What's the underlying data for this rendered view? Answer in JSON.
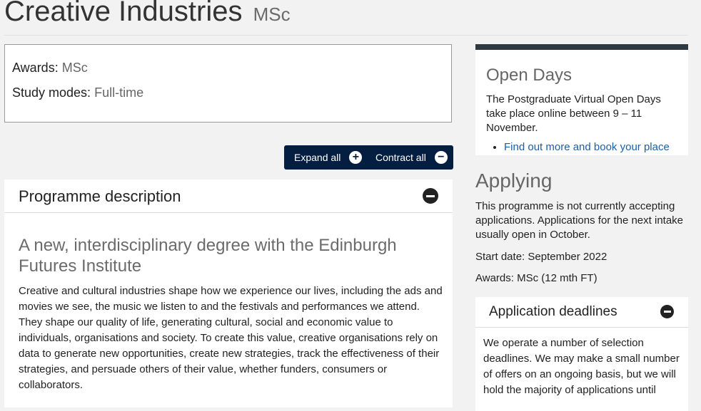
{
  "header": {
    "title": "Creative Industries",
    "award": "MSc"
  },
  "summary": {
    "awards_label": "Awards:",
    "awards_value": "MSc",
    "study_modes_label": "Study modes:",
    "study_modes_value": "Full-time"
  },
  "toolbar": {
    "expand_label": "Expand all",
    "contract_label": "Contract all",
    "expand_icon": "plus-circle-icon",
    "contract_icon": "minus-circle-icon"
  },
  "programme": {
    "section_title": "Programme description",
    "collapse_icon": "minus-circle-icon",
    "subheading": "A new, interdisciplinary degree with the Edinburgh Futures Institute",
    "body": "Creative and cultural industries shape how we experience our lives, including the ads and movies we see, the music we listen to and the festivals and performances we attend. They shape our quality of life, generating cultural, social and economic value to individuals, organisations and society. To create this value, creative organisations rely on data to generate new opportunities, create new strategies, track the effectiveness of their strategies, and persuade others of their value, whether funders, consumers or collaborators."
  },
  "open_days": {
    "title": "Open Days",
    "text": "The Postgraduate Virtual Open Days take place online between 9 – 11 November.",
    "link": "Find out more and book your place"
  },
  "applying": {
    "title": "Applying",
    "text": "This programme is not currently accepting applications. Applications for the next intake usually open in October.",
    "start_date": "Start date: September 2022",
    "awards": "Awards: MSc (12 mth FT)"
  },
  "deadlines": {
    "title": "Application deadlines",
    "collapse_icon": "minus-circle-icon",
    "text": "We operate a number of selection deadlines. We may make a small number of offers on an ongoing basis, but we will hold the majority of applications until"
  },
  "colors": {
    "background": "#f2f2f2",
    "toolbar": "#041e42",
    "sidebar_accent": "#2d3a44",
    "link": "#1a5fa8"
  }
}
